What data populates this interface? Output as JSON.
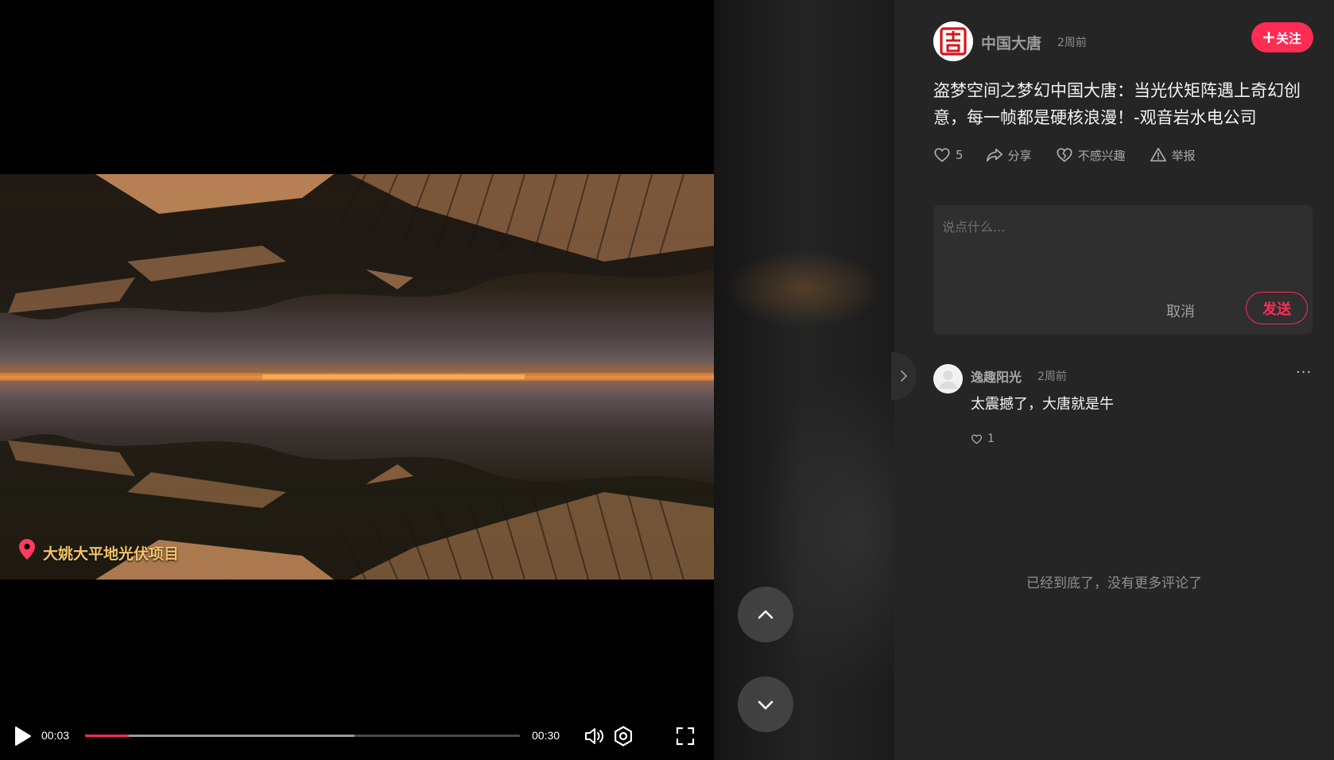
{
  "video": {
    "location": "大姚大平地光伏项目",
    "current_time": "00:03",
    "total_time": "00:30",
    "progress_fraction": 0.1,
    "buffered_fraction": 0.62
  },
  "icons": {
    "play": "play-icon",
    "volume": "volume-icon",
    "settings": "settings-icon",
    "fullscreen": "fullscreen-icon",
    "location": "location-pin-icon",
    "prev": "chevron-up-icon",
    "next": "chevron-down-icon",
    "collapse": "chevron-right-icon"
  },
  "colors": {
    "accent": "#fe2c55",
    "panel_bg": "#252525"
  },
  "post": {
    "author": "中国大唐",
    "time": "2周前",
    "follow_label": "关注",
    "title": "盗梦空间之梦幻中国大唐：当光伏矩阵遇上奇幻创意，每一帧都是硬核浪漫！-观音岩水电公司",
    "actions": {
      "like_count": "5",
      "share": "分享",
      "not_interested": "不感兴趣",
      "report": "举报"
    }
  },
  "comment_box": {
    "placeholder": "说点什么...",
    "cancel": "取消",
    "send": "发送"
  },
  "comments": [
    {
      "user": "逸趣阳光",
      "time": "2周前",
      "text": "太震撼了，大唐就是牛",
      "likes": "1",
      "more": "···"
    }
  ],
  "end_note": "已经到底了，没有更多评论了"
}
